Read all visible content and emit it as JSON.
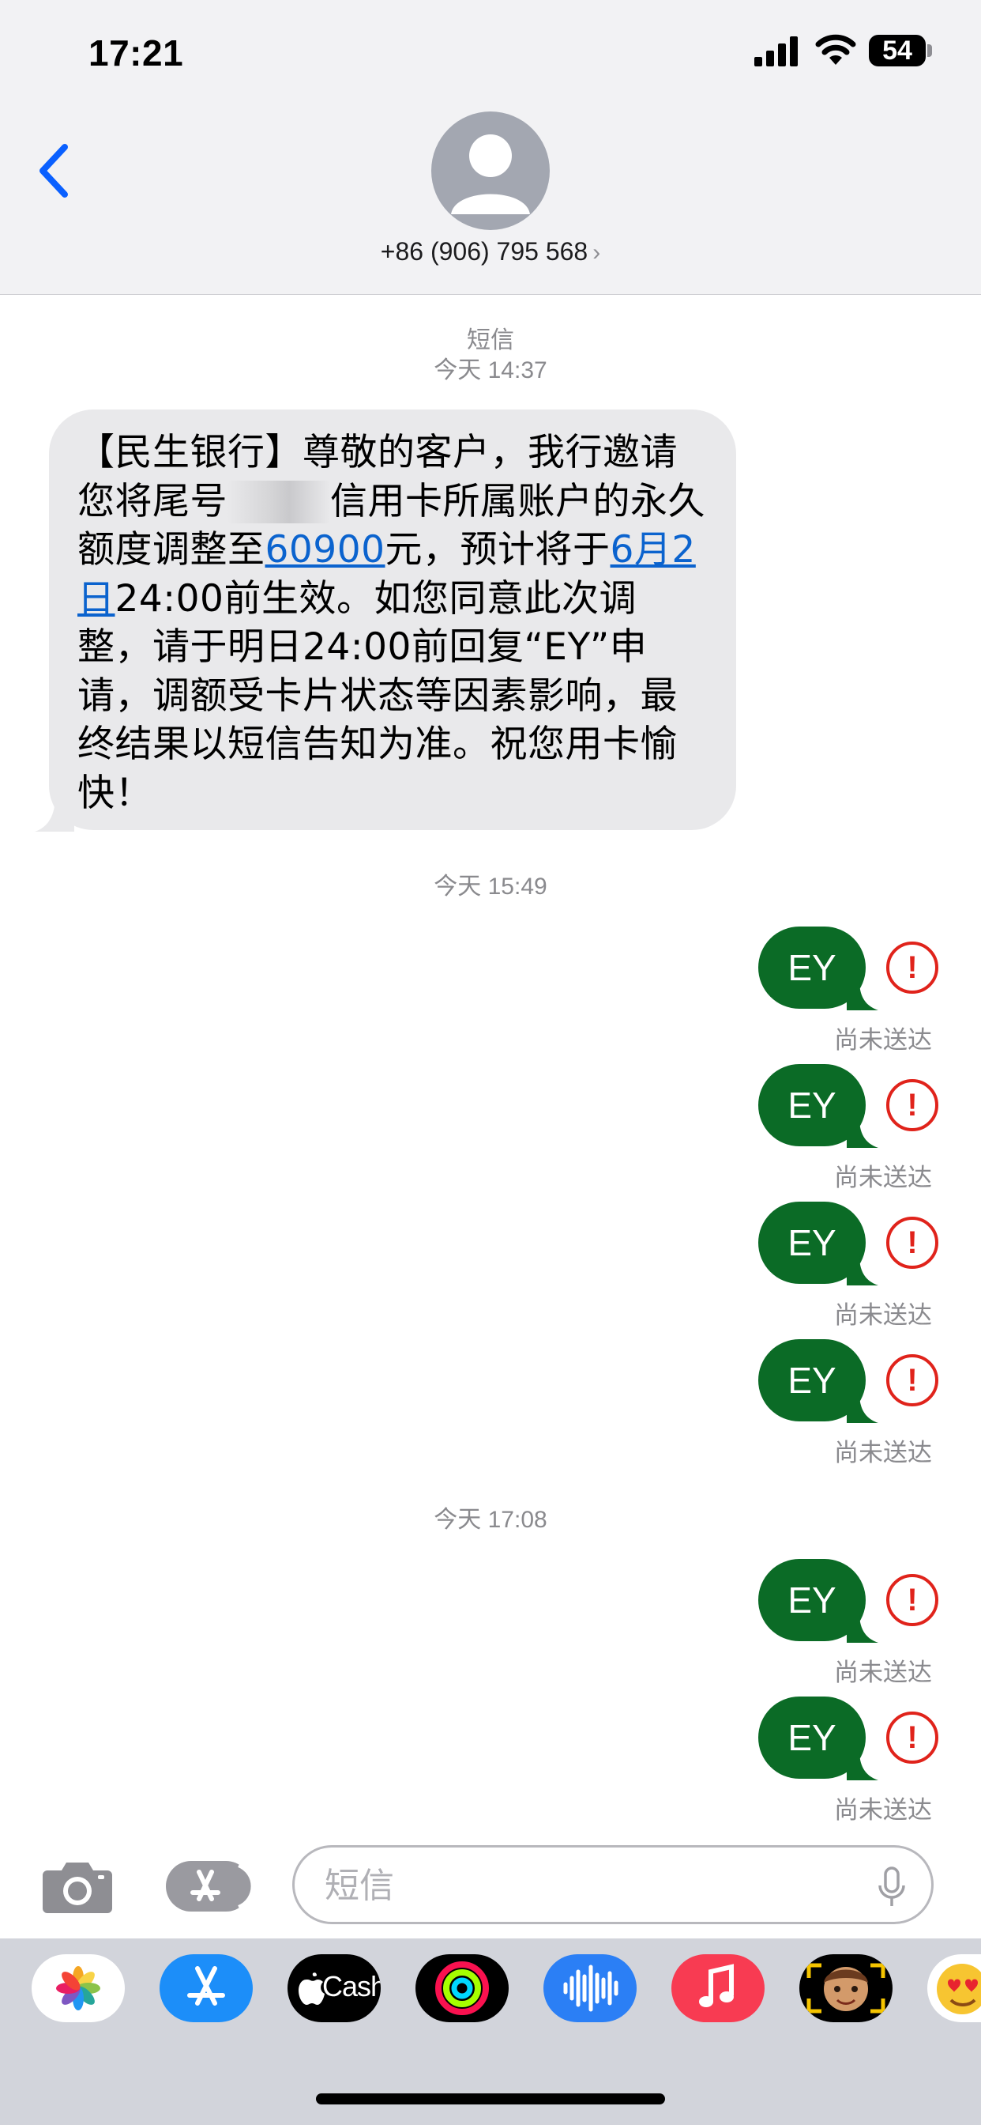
{
  "status_bar": {
    "time": "17:21",
    "battery": "54"
  },
  "header": {
    "contact": "+86 (906) 795 568",
    "chevron": "›"
  },
  "conversation": {
    "service_label": "短信",
    "groups": [
      {
        "timestamp": "今天 14:37"
      },
      {
        "timestamp": "今天 15:49"
      },
      {
        "timestamp": "今天 17:08"
      }
    ],
    "incoming": {
      "text_a": "【民生银行】尊敬的客户，我行邀请您将尾号",
      "text_b": "信用卡所属账户的永久额度调整至",
      "amount": "60900",
      "text_c": "元，预计将于",
      "date": "6月2日",
      "text_d": "24:00前生效。如您同意此次调整，请于明日24:00前回复“EY”申请，调额受卡片状态等因素影响，最终结果以短信告知为准。祝您用卡愉快！"
    },
    "outgoing": [
      {
        "text": "EY",
        "status": "尚未送达"
      },
      {
        "text": "EY",
        "status": "尚未送达"
      },
      {
        "text": "EY",
        "status": "尚未送达"
      },
      {
        "text": "EY",
        "status": "尚未送达"
      },
      {
        "text": "EY",
        "status": "尚未送达"
      },
      {
        "text": "EY",
        "status": "尚未送达"
      }
    ],
    "error_glyph": "!"
  },
  "compose": {
    "placeholder": "短信"
  },
  "app_drawer": {
    "apps": [
      {
        "name": "photos-app-icon"
      },
      {
        "name": "app-store-app-icon"
      },
      {
        "name": "cash-app-icon",
        "label": "Cash"
      },
      {
        "name": "activity-app-icon"
      },
      {
        "name": "audio-message-app-icon"
      },
      {
        "name": "music-app-icon"
      },
      {
        "name": "memoji-app-icon"
      },
      {
        "name": "animoji-app-icon"
      }
    ]
  },
  "colors": {
    "outgoing_bubble": "#0b6b26",
    "error_red": "#e0231b",
    "link_blue": "#0b63ce"
  }
}
